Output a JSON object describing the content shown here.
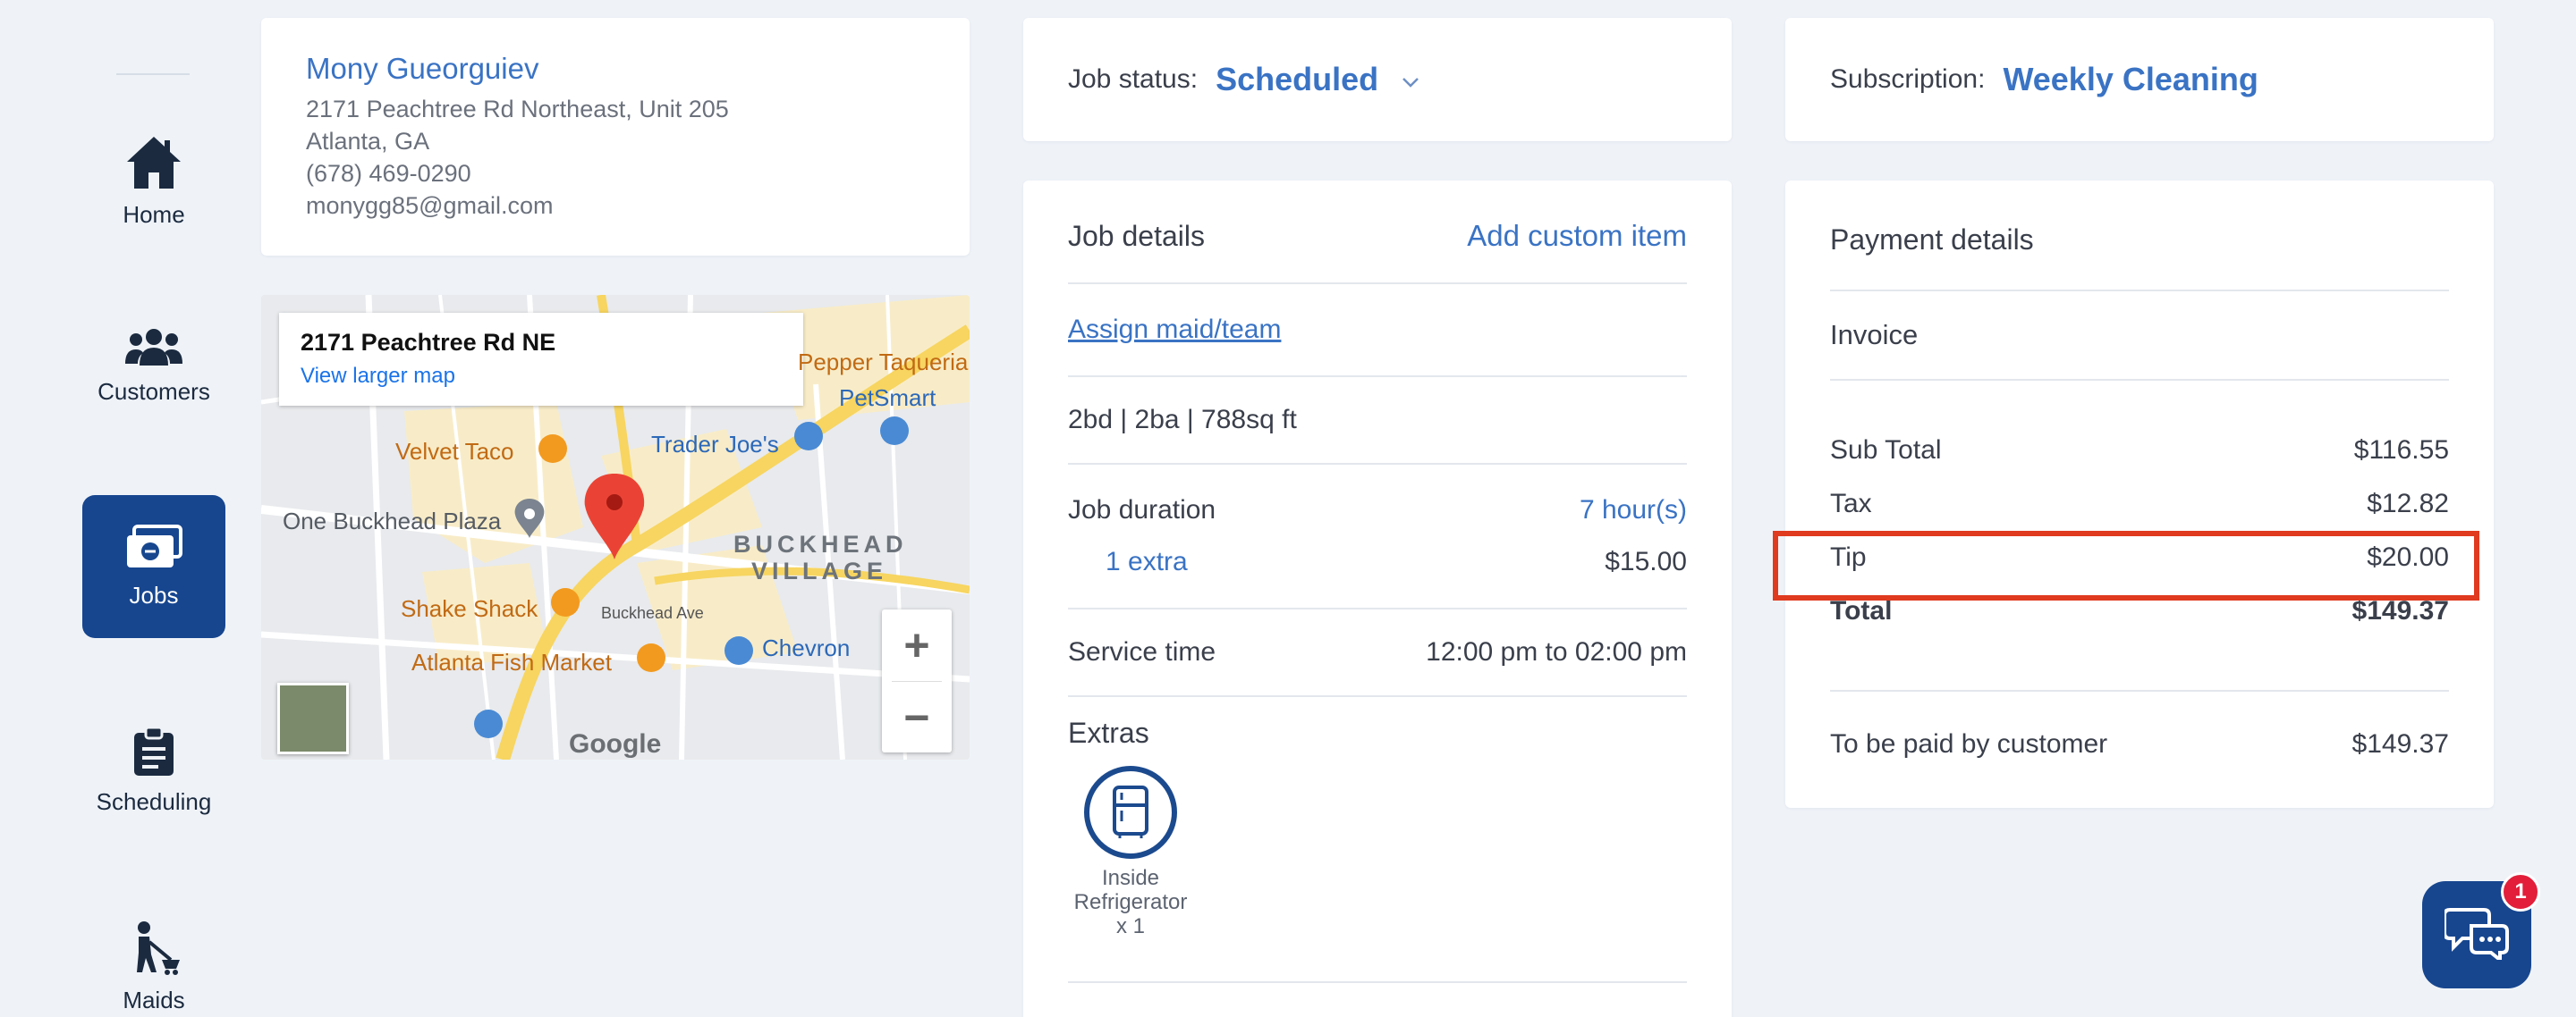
{
  "sidebar": {
    "items": [
      {
        "label": "Home",
        "icon": "home-icon"
      },
      {
        "label": "Customers",
        "icon": "users-icon"
      },
      {
        "label": "Jobs",
        "icon": "jobs-icon",
        "active": true
      },
      {
        "label": "Scheduling",
        "icon": "clipboard-icon"
      },
      {
        "label": "Maids",
        "icon": "maid-icon"
      }
    ]
  },
  "customer": {
    "name": "Mony Gueorguiev",
    "address": "2171 Peachtree Rd Northeast, Unit 205",
    "city": "Atlanta, GA",
    "phone": "(678) 469-0290",
    "email": "monygg85@gmail.com"
  },
  "map": {
    "info_address": "2171 Peachtree Rd NE",
    "view_larger": "View larger map",
    "places": {
      "velvet_taco": "Velvet Taco",
      "trader_joes": "Trader Joe's",
      "petsmart": "PetSmart",
      "pepper_taqueria": "Pepper Taqueria",
      "one_buckhead": "One Buckhead Plaza",
      "buckhead": "BUCKHEAD",
      "village": "VILLAGE",
      "shake_shack": "Shake Shack",
      "atlanta_fish": "Atlanta Fish Market",
      "chevron": "Chevron",
      "buckhead_ave": "Buckhead Ave",
      "google": "Google"
    },
    "zoom_in": "+",
    "zoom_out": "−"
  },
  "job_status": {
    "label": "Job status:",
    "value": "Scheduled"
  },
  "job_details": {
    "title": "Job details",
    "add_custom": "Add custom item",
    "assign": "Assign maid/team",
    "property": "2bd | 2ba | 788sq ft",
    "duration_label": "Job duration",
    "duration_value": "7 hour(s)",
    "extra_label": "1 extra",
    "extra_price": "$15.00",
    "service_label": "Service time",
    "service_value": "12:00 pm to 02:00 pm",
    "extras_title": "Extras",
    "extras": [
      {
        "label": "Inside Refrigerator x 1",
        "icon": "refrigerator-icon"
      }
    ]
  },
  "subscription": {
    "label": "Subscription:",
    "value": "Weekly Cleaning"
  },
  "payment": {
    "title": "Payment details",
    "invoice": "Invoice",
    "subtotal_label": "Sub Total",
    "subtotal": "$116.55",
    "tax_label": "Tax",
    "tax": "$12.82",
    "tip_label": "Tip",
    "tip": "$20.00",
    "total_label": "Total",
    "total": "$149.37",
    "to_pay_label": "To be paid by customer",
    "to_pay": "$149.37"
  },
  "chat": {
    "badge": "1"
  },
  "colors": {
    "accent": "#3a73c4",
    "brand": "#17468f",
    "highlight": "#e03a1f",
    "badge": "#e21e3a"
  }
}
